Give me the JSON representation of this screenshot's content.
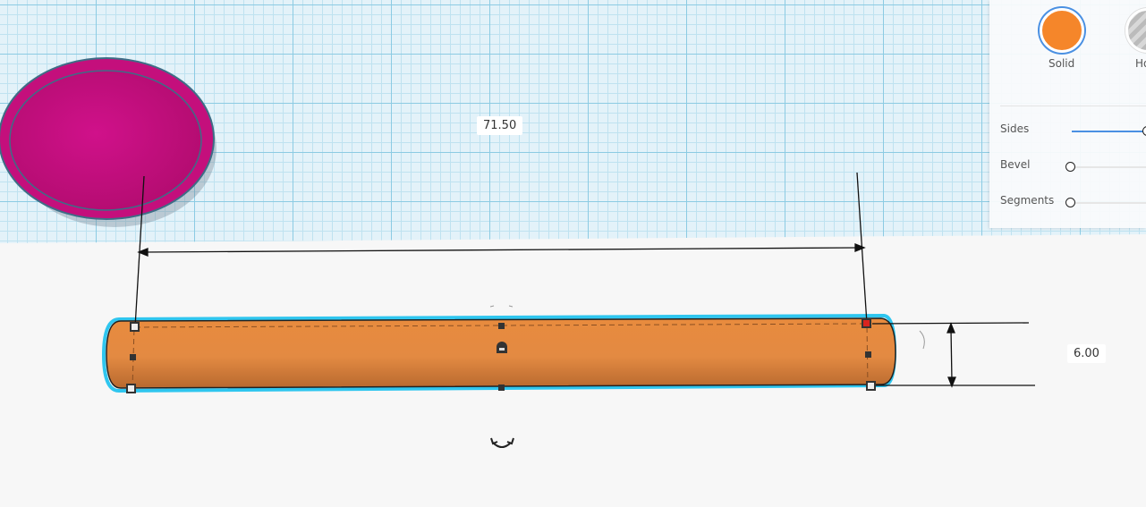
{
  "workplane": {
    "dimensions": {
      "length": "71.50",
      "height": "6.00"
    }
  },
  "shape_panel": {
    "types": [
      {
        "label": "Solid",
        "selected": true,
        "color": "#f5862a"
      },
      {
        "label": "Ho",
        "selected": false
      }
    ],
    "properties": [
      {
        "label": "Sides",
        "value_fraction": 1.0
      },
      {
        "label": "Bevel",
        "value_fraction": 0.0
      },
      {
        "label": "Segments",
        "value_fraction": 0.0
      }
    ]
  },
  "colors": {
    "cylinder": "#e38a3f",
    "selection": "#2fc6ef",
    "bowl": "#c8117f"
  }
}
